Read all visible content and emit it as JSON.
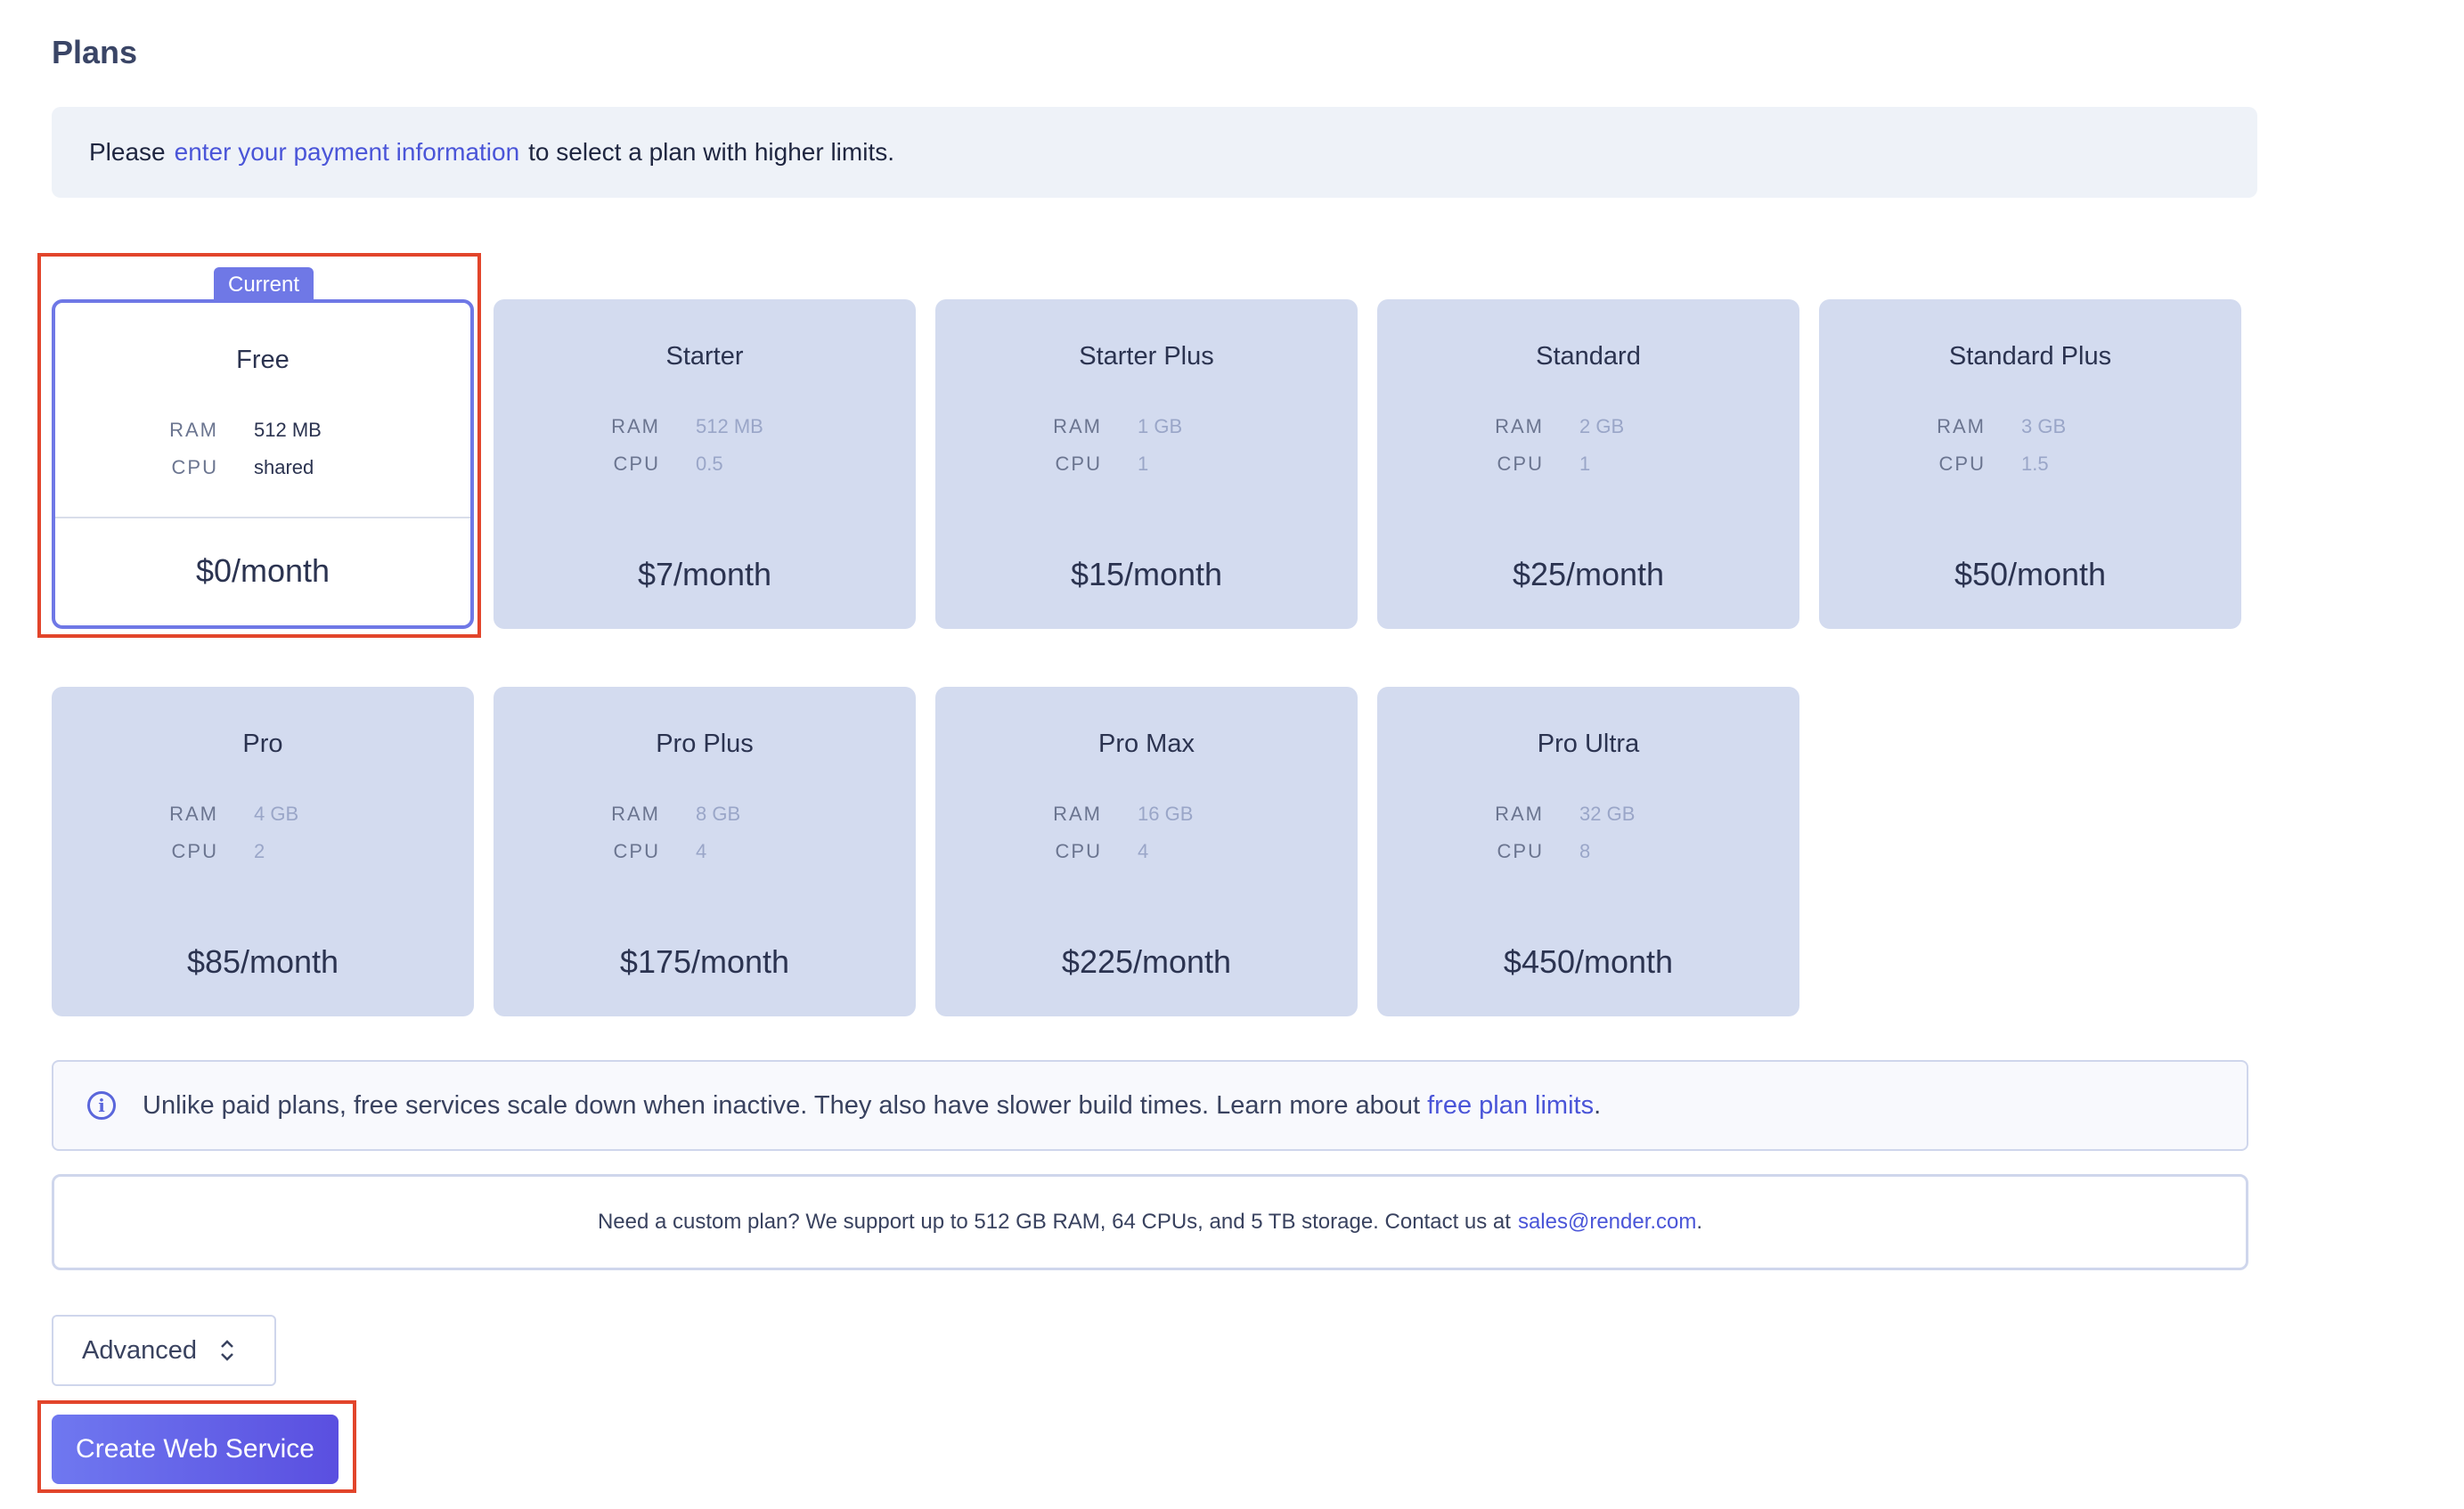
{
  "header": {
    "title": "Plans"
  },
  "notice": {
    "prefix": "Please",
    "link": "enter your payment information",
    "suffix": "to select a plan with higher limits."
  },
  "plans": {
    "current_badge": "Current",
    "ram_label": "RAM",
    "cpu_label": "CPU",
    "items": [
      {
        "name": "Free",
        "ram": "512 MB",
        "cpu": "shared",
        "price": "$0/month"
      },
      {
        "name": "Starter",
        "ram": "512 MB",
        "cpu": "0.5",
        "price": "$7/month"
      },
      {
        "name": "Starter Plus",
        "ram": "1 GB",
        "cpu": "1",
        "price": "$15/month"
      },
      {
        "name": "Standard",
        "ram": "2 GB",
        "cpu": "1",
        "price": "$25/month"
      },
      {
        "name": "Standard Plus",
        "ram": "3 GB",
        "cpu": "1.5",
        "price": "$50/month"
      },
      {
        "name": "Pro",
        "ram": "4 GB",
        "cpu": "2",
        "price": "$85/month"
      },
      {
        "name": "Pro Plus",
        "ram": "8 GB",
        "cpu": "4",
        "price": "$175/month"
      },
      {
        "name": "Pro Max",
        "ram": "16 GB",
        "cpu": "4",
        "price": "$225/month"
      },
      {
        "name": "Pro Ultra",
        "ram": "32 GB",
        "cpu": "8",
        "price": "$450/month"
      }
    ]
  },
  "info": {
    "text": "Unlike paid plans, free services scale down when inactive. They also have slower build times. Learn more about",
    "link": "free plan limits",
    "end": "."
  },
  "custom": {
    "text": "Need a custom plan? We support up to 512 GB RAM, 64 CPUs, and 5 TB storage. Contact us at",
    "email": "sales@render.com",
    "end": "."
  },
  "advanced": {
    "label": "Advanced"
  },
  "actions": {
    "create_label": "Create Web Service"
  },
  "colors": {
    "accent": "#6f78e6",
    "link": "#4a55d8",
    "highlight": "#e2452b",
    "card_bg": "#d3dbef"
  }
}
